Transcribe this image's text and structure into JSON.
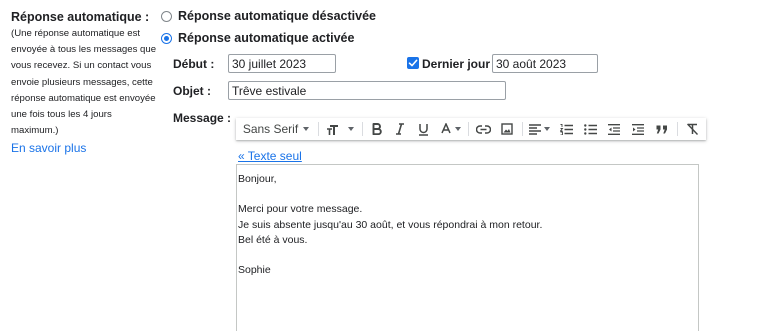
{
  "sidebar": {
    "title": "Réponse automatique :",
    "description": "(Une réponse automatique est envoyée à tous les messages que vous recevez. Si un contact vous envoie plusieurs messages, cette réponse automatique est envoyée une fois tous les 4 jours maximum.)",
    "learn_more": "En savoir plus"
  },
  "options": {
    "off_label": "Réponse automatique désactivée",
    "on_label": "Réponse automatique activée",
    "selected": "on"
  },
  "fields": {
    "start_label": "Début :",
    "start_value": "30 juillet 2023",
    "last_day_label": "Dernier jour :",
    "last_day_checked": true,
    "last_day_value": "30 août 2023",
    "subject_label": "Objet :",
    "subject_value": "Trêve estivale",
    "message_label": "Message :"
  },
  "toolbar": {
    "font": "Sans Serif",
    "icons": [
      "text-size-icon",
      "bold-icon",
      "italic-icon",
      "underline-icon",
      "text-color-icon",
      "link-icon",
      "image-icon",
      "align-icon",
      "numbered-list-icon",
      "bulleted-list-icon",
      "indent-less-icon",
      "indent-more-icon",
      "quote-icon",
      "remove-formatting-icon"
    ]
  },
  "editor": {
    "plain_text_link": "« Texte seul",
    "lines": [
      "Bonjour,",
      "",
      "Merci pour votre message.",
      "Je suis absente jusqu'au 30 août, et vous répondrai à mon retour.",
      "Bel été à vous.",
      "",
      "Sophie"
    ]
  },
  "colors": {
    "accent": "#1a73e8",
    "text": "#202124",
    "icon": "#444746"
  }
}
